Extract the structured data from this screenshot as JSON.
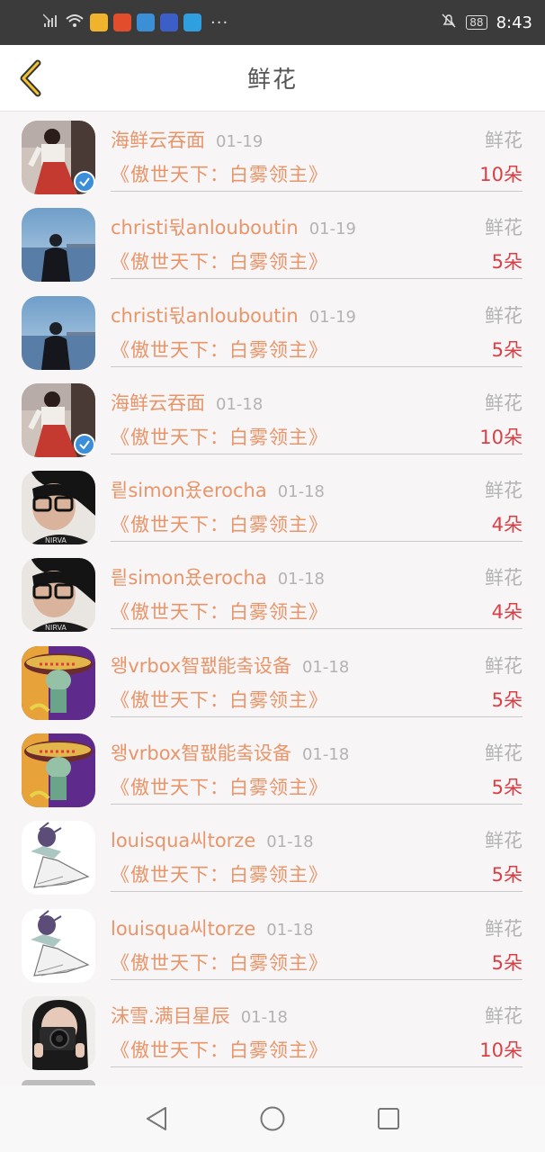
{
  "status_bar": {
    "battery": "88",
    "time": "8:43",
    "dots": "···"
  },
  "header": {
    "title": "鲜花"
  },
  "rows": [
    {
      "name": "海鲜云吞面",
      "date": "01-19",
      "type": "鲜花",
      "book": "《傲世天下：白雾领主》",
      "count": "10朵",
      "avatar": "red-dress",
      "verified": true
    },
    {
      "name": "christi뒧anlouboutin",
      "date": "01-19",
      "type": "鲜花",
      "book": "《傲世天下：白雾领主》",
      "count": "5朵",
      "avatar": "sea-man",
      "verified": false
    },
    {
      "name": "christi뒧anlouboutin",
      "date": "01-19",
      "type": "鲜花",
      "book": "《傲世天下：白雾领主》",
      "count": "5朵",
      "avatar": "sea-man",
      "verified": false
    },
    {
      "name": "海鲜云吞面",
      "date": "01-18",
      "type": "鲜花",
      "book": "《傲世天下：白雾领主》",
      "count": "10朵",
      "avatar": "red-dress",
      "verified": true
    },
    {
      "name": "릩simon욨erocha",
      "date": "01-18",
      "type": "鲜花",
      "book": "《傲世天下：白雾领主》",
      "count": "4朵",
      "avatar": "glasses-girl",
      "verified": false
    },
    {
      "name": "릩simon욨erocha",
      "date": "01-18",
      "type": "鲜花",
      "book": "《傲世天下：白雾领主》",
      "count": "4朵",
      "avatar": "glasses-girl",
      "verified": false
    },
    {
      "name": "왱vrbox智퐶能춬设备",
      "date": "01-18",
      "type": "鲜花",
      "book": "《傲世天下：白雾领主》",
      "count": "5朵",
      "avatar": "cartoon-sombrero",
      "verified": false
    },
    {
      "name": "왱vrbox智퐶能춬设备",
      "date": "01-18",
      "type": "鲜花",
      "book": "《傲世天下：白雾领主》",
      "count": "5朵",
      "avatar": "cartoon-sombrero",
      "verified": false
    },
    {
      "name": "louisqua씨torze",
      "date": "01-18",
      "type": "鲜花",
      "book": "《傲世天下：白雾领主》",
      "count": "5朵",
      "avatar": "anime-figure",
      "verified": false
    },
    {
      "name": "louisqua씨torze",
      "date": "01-18",
      "type": "鲜花",
      "book": "《傲世天下：白雾领主》",
      "count": "5朵",
      "avatar": "anime-figure",
      "verified": false
    },
    {
      "name": "沫雪.满目星辰",
      "date": "01-18",
      "type": "鲜花",
      "book": "《傲世天下：白雾领主》",
      "count": "10朵",
      "avatar": "camera-girl",
      "verified": false
    }
  ],
  "nav": {
    "back": "back-triangle-icon",
    "home": "home-circle-icon",
    "recent": "recent-square-icon"
  }
}
